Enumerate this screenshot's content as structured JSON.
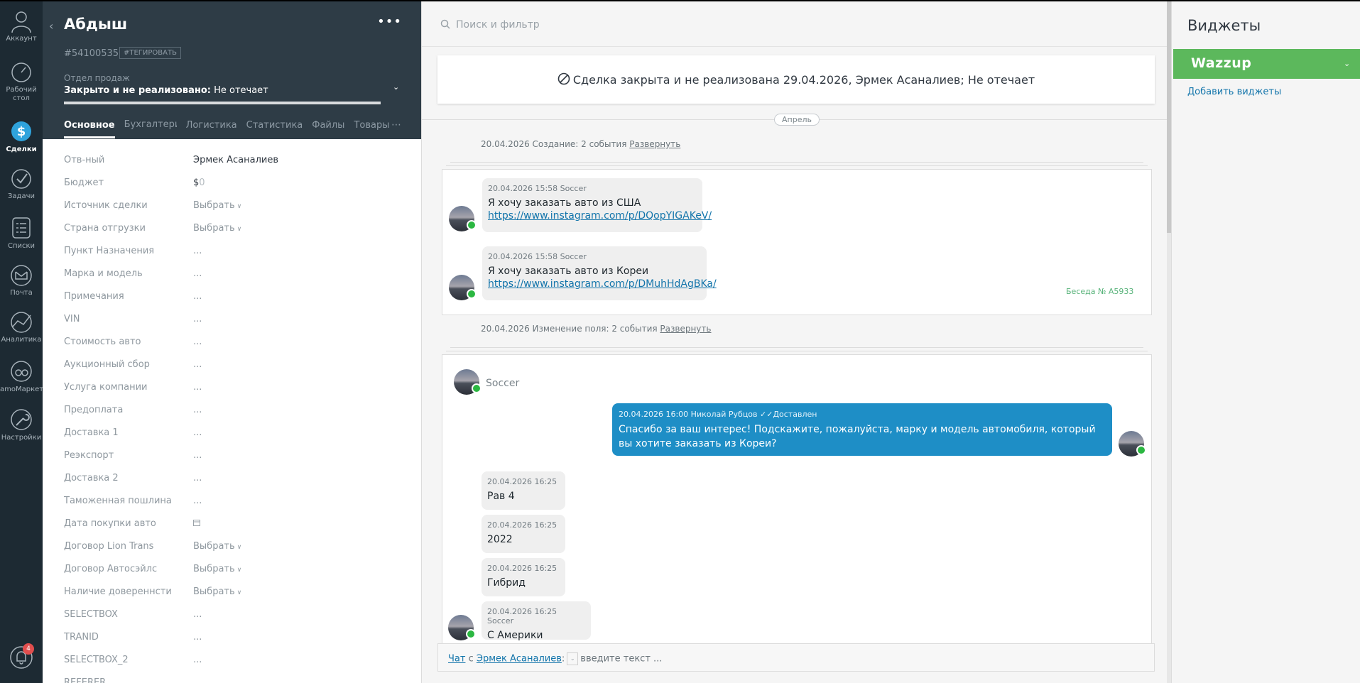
{
  "nav": {
    "items": [
      {
        "key": "account",
        "label": "Аккаунт"
      },
      {
        "key": "dashboard",
        "label": "Рабочий стол"
      },
      {
        "key": "deals",
        "label": "Сделки"
      },
      {
        "key": "tasks",
        "label": "Задачи"
      },
      {
        "key": "lists",
        "label": "Списки"
      },
      {
        "key": "mail",
        "label": "Почта"
      },
      {
        "key": "analytics",
        "label": "Аналитика"
      },
      {
        "key": "market",
        "label": "amoМаркет"
      },
      {
        "key": "settings",
        "label": "Настройки"
      }
    ],
    "notifications_count": "4"
  },
  "card": {
    "title": "Абдыш",
    "id": "#54100535",
    "tag_button": "#ТЕГИРОВАТЬ",
    "pipeline": "Отдел продаж",
    "status_bold": "Закрыто и не реализовано:",
    "status_reason": " Не отечает",
    "tabs": [
      "Основное",
      "Бухгалтерия",
      "Логистика",
      "Статистика",
      "Файлы",
      "Товары"
    ],
    "fields": [
      {
        "label": "Отв-ный",
        "value": "Эрмек Асаналиев",
        "type": "text"
      },
      {
        "label": "Бюджет",
        "value": "$",
        "type": "budget",
        "extra": "0"
      },
      {
        "label": "Источник сделки",
        "value": "Выбрать",
        "type": "select"
      },
      {
        "label": "Страна отгрузки",
        "value": "Выбрать",
        "type": "select"
      },
      {
        "label": "Пункт Назначения",
        "value": "...",
        "type": "empty"
      },
      {
        "label": "Марка и модель",
        "value": "...",
        "type": "empty"
      },
      {
        "label": "Примечания",
        "value": "...",
        "type": "empty"
      },
      {
        "label": "VIN",
        "value": "...",
        "type": "empty"
      },
      {
        "label": "Стоимость авто",
        "value": "...",
        "type": "empty"
      },
      {
        "label": "Аукционный сбор",
        "value": "...",
        "type": "empty"
      },
      {
        "label": "Услуга компании",
        "value": "...",
        "type": "empty"
      },
      {
        "label": "Предоплата",
        "value": "...",
        "type": "empty"
      },
      {
        "label": "Доставка 1",
        "value": "...",
        "type": "empty"
      },
      {
        "label": "Реэкспорт",
        "value": "...",
        "type": "empty"
      },
      {
        "label": "Доставка 2",
        "value": "...",
        "type": "empty"
      },
      {
        "label": "Таможенная пошлина",
        "value": "...",
        "type": "empty"
      },
      {
        "label": "Дата покупки авто",
        "value": "",
        "type": "date"
      },
      {
        "label": "Договор Lion Trans",
        "value": "Выбрать",
        "type": "select"
      },
      {
        "label": "Договор Автосэйлс",
        "value": "Выбрать",
        "type": "select"
      },
      {
        "label": "Наличие довереннсти",
        "value": "Выбрать",
        "type": "select"
      },
      {
        "label": "SELECTBOX",
        "value": "...",
        "type": "empty"
      },
      {
        "label": "TRANID",
        "value": "...",
        "type": "empty"
      },
      {
        "label": "SELECTBOX_2",
        "value": "...",
        "type": "empty"
      },
      {
        "label": "REFERER",
        "value": "",
        "type": "empty"
      }
    ]
  },
  "feed": {
    "search_placeholder": "Поиск и фильтр",
    "closed_notice": "Сделка закрыта и не реализована 29.04.2026, Эрмек Асаналиев; Не отечает",
    "month": "Апрель",
    "group1": {
      "header": "20.04.2026 Создание: 2 события",
      "expand": "Развернуть"
    },
    "msg1": {
      "meta": "20.04.2026 15:58 Soccer",
      "text": "Я хочу заказать авто из США",
      "link": "https://www.instagram.com/p/DQopYIGAKeV/"
    },
    "msg2": {
      "meta": "20.04.2026 15:58 Soccer",
      "text": "Я хочу заказать авто из Кореи",
      "link": "https://www.instagram.com/p/DMuhHdAgBKa/"
    },
    "conversation": "Беседа № A5933",
    "group2": {
      "header": "20.04.2026 Изменение поля: 2 события",
      "expand": "Развернуть"
    },
    "contact_name": "Soccer",
    "outgoing": {
      "meta": "20.04.2026 16:00 Николай Рубцов",
      "status": "Доставлен",
      "text": "Спасибо за ваш интерес! Подскажите, пожалуйста, марку и модель автомобиля, который вы хотите заказать из Кореи?"
    },
    "replies": [
      {
        "meta": "20.04.2026 16:25",
        "text": "Рав 4"
      },
      {
        "meta": "20.04.2026 16:25",
        "text": "2022"
      },
      {
        "meta": "20.04.2026 16:25",
        "text": "Гибрид"
      },
      {
        "meta": "20.04.2026 16:25 Soccer",
        "text": "С Америки"
      }
    ],
    "chat_bar": {
      "chat_word": "Чат",
      "with": " с ",
      "contact": "Эрмек Асаналиев",
      "colon": ":",
      "placeholder": "введите текст ..."
    }
  },
  "widgets": {
    "title": "Виджеты",
    "wazzup": "Wazzup",
    "add": "Добавить виджеты"
  },
  "colors": {
    "accent": "#1e8ec6",
    "widget_green": "#5cb85c",
    "whatsapp": "#2bb741",
    "nav_bg": "#1d2a33",
    "card_head": "#2e3c46"
  }
}
